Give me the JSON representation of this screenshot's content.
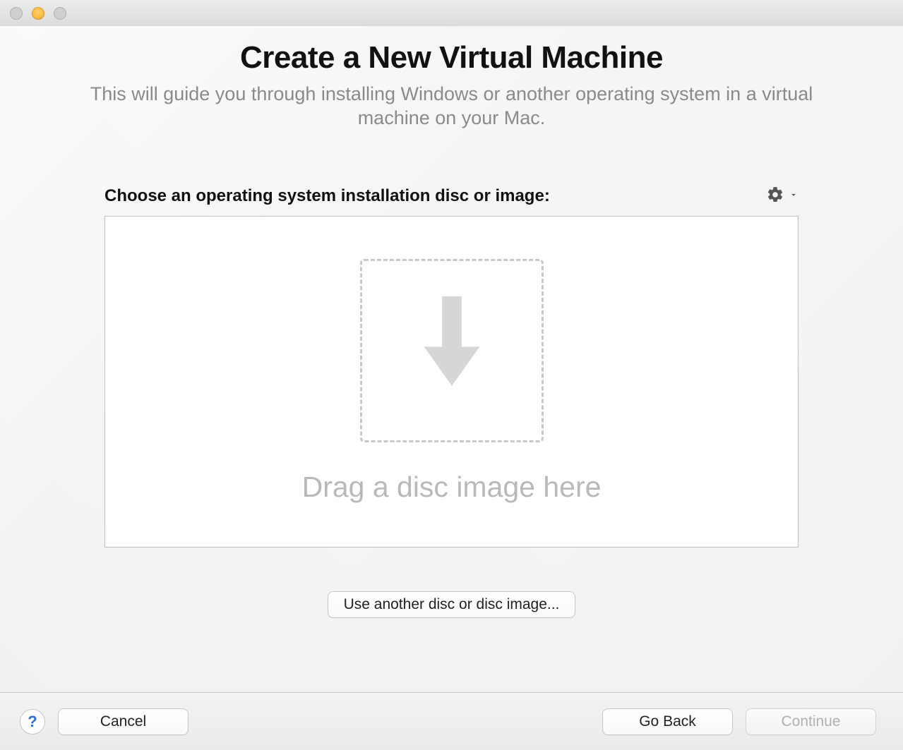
{
  "header": {
    "title": "Create a New Virtual Machine",
    "subtitle": "This will guide you through installing Windows or another operating system in a virtual machine on your Mac."
  },
  "main": {
    "choose_label": "Choose an operating system installation disc or image:",
    "drop_text": "Drag a disc image here",
    "use_another_label": "Use another disc or disc image..."
  },
  "footer": {
    "help": "?",
    "cancel": "Cancel",
    "go_back": "Go Back",
    "continue": "Continue"
  },
  "icons": {
    "gear": "gear-icon",
    "chevron": "chevron-down-icon",
    "download_arrow": "download-arrow-icon"
  },
  "colors": {
    "text_muted": "#8a8a8a",
    "drop_muted": "#b9b9b9",
    "help_blue": "#2a6fd6"
  }
}
